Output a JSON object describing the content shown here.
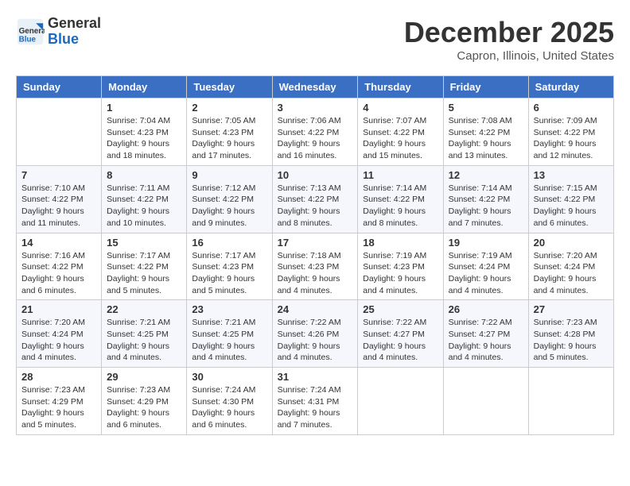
{
  "header": {
    "logo_general": "General",
    "logo_blue": "Blue",
    "month_title": "December 2025",
    "location": "Capron, Illinois, United States"
  },
  "days_of_week": [
    "Sunday",
    "Monday",
    "Tuesday",
    "Wednesday",
    "Thursday",
    "Friday",
    "Saturday"
  ],
  "weeks": [
    [
      {
        "day": "",
        "info": ""
      },
      {
        "day": "1",
        "info": "Sunrise: 7:04 AM\nSunset: 4:23 PM\nDaylight: 9 hours\nand 18 minutes."
      },
      {
        "day": "2",
        "info": "Sunrise: 7:05 AM\nSunset: 4:23 PM\nDaylight: 9 hours\nand 17 minutes."
      },
      {
        "day": "3",
        "info": "Sunrise: 7:06 AM\nSunset: 4:22 PM\nDaylight: 9 hours\nand 16 minutes."
      },
      {
        "day": "4",
        "info": "Sunrise: 7:07 AM\nSunset: 4:22 PM\nDaylight: 9 hours\nand 15 minutes."
      },
      {
        "day": "5",
        "info": "Sunrise: 7:08 AM\nSunset: 4:22 PM\nDaylight: 9 hours\nand 13 minutes."
      },
      {
        "day": "6",
        "info": "Sunrise: 7:09 AM\nSunset: 4:22 PM\nDaylight: 9 hours\nand 12 minutes."
      }
    ],
    [
      {
        "day": "7",
        "info": "Sunrise: 7:10 AM\nSunset: 4:22 PM\nDaylight: 9 hours\nand 11 minutes."
      },
      {
        "day": "8",
        "info": "Sunrise: 7:11 AM\nSunset: 4:22 PM\nDaylight: 9 hours\nand 10 minutes."
      },
      {
        "day": "9",
        "info": "Sunrise: 7:12 AM\nSunset: 4:22 PM\nDaylight: 9 hours\nand 9 minutes."
      },
      {
        "day": "10",
        "info": "Sunrise: 7:13 AM\nSunset: 4:22 PM\nDaylight: 9 hours\nand 8 minutes."
      },
      {
        "day": "11",
        "info": "Sunrise: 7:14 AM\nSunset: 4:22 PM\nDaylight: 9 hours\nand 8 minutes."
      },
      {
        "day": "12",
        "info": "Sunrise: 7:14 AM\nSunset: 4:22 PM\nDaylight: 9 hours\nand 7 minutes."
      },
      {
        "day": "13",
        "info": "Sunrise: 7:15 AM\nSunset: 4:22 PM\nDaylight: 9 hours\nand 6 minutes."
      }
    ],
    [
      {
        "day": "14",
        "info": "Sunrise: 7:16 AM\nSunset: 4:22 PM\nDaylight: 9 hours\nand 6 minutes."
      },
      {
        "day": "15",
        "info": "Sunrise: 7:17 AM\nSunset: 4:22 PM\nDaylight: 9 hours\nand 5 minutes."
      },
      {
        "day": "16",
        "info": "Sunrise: 7:17 AM\nSunset: 4:23 PM\nDaylight: 9 hours\nand 5 minutes."
      },
      {
        "day": "17",
        "info": "Sunrise: 7:18 AM\nSunset: 4:23 PM\nDaylight: 9 hours\nand 4 minutes."
      },
      {
        "day": "18",
        "info": "Sunrise: 7:19 AM\nSunset: 4:23 PM\nDaylight: 9 hours\nand 4 minutes."
      },
      {
        "day": "19",
        "info": "Sunrise: 7:19 AM\nSunset: 4:24 PM\nDaylight: 9 hours\nand 4 minutes."
      },
      {
        "day": "20",
        "info": "Sunrise: 7:20 AM\nSunset: 4:24 PM\nDaylight: 9 hours\nand 4 minutes."
      }
    ],
    [
      {
        "day": "21",
        "info": "Sunrise: 7:20 AM\nSunset: 4:24 PM\nDaylight: 9 hours\nand 4 minutes."
      },
      {
        "day": "22",
        "info": "Sunrise: 7:21 AM\nSunset: 4:25 PM\nDaylight: 9 hours\nand 4 minutes."
      },
      {
        "day": "23",
        "info": "Sunrise: 7:21 AM\nSunset: 4:25 PM\nDaylight: 9 hours\nand 4 minutes."
      },
      {
        "day": "24",
        "info": "Sunrise: 7:22 AM\nSunset: 4:26 PM\nDaylight: 9 hours\nand 4 minutes."
      },
      {
        "day": "25",
        "info": "Sunrise: 7:22 AM\nSunset: 4:27 PM\nDaylight: 9 hours\nand 4 minutes."
      },
      {
        "day": "26",
        "info": "Sunrise: 7:22 AM\nSunset: 4:27 PM\nDaylight: 9 hours\nand 4 minutes."
      },
      {
        "day": "27",
        "info": "Sunrise: 7:23 AM\nSunset: 4:28 PM\nDaylight: 9 hours\nand 5 minutes."
      }
    ],
    [
      {
        "day": "28",
        "info": "Sunrise: 7:23 AM\nSunset: 4:29 PM\nDaylight: 9 hours\nand 5 minutes."
      },
      {
        "day": "29",
        "info": "Sunrise: 7:23 AM\nSunset: 4:29 PM\nDaylight: 9 hours\nand 6 minutes."
      },
      {
        "day": "30",
        "info": "Sunrise: 7:24 AM\nSunset: 4:30 PM\nDaylight: 9 hours\nand 6 minutes."
      },
      {
        "day": "31",
        "info": "Sunrise: 7:24 AM\nSunset: 4:31 PM\nDaylight: 9 hours\nand 7 minutes."
      },
      {
        "day": "",
        "info": ""
      },
      {
        "day": "",
        "info": ""
      },
      {
        "day": "",
        "info": ""
      }
    ]
  ]
}
